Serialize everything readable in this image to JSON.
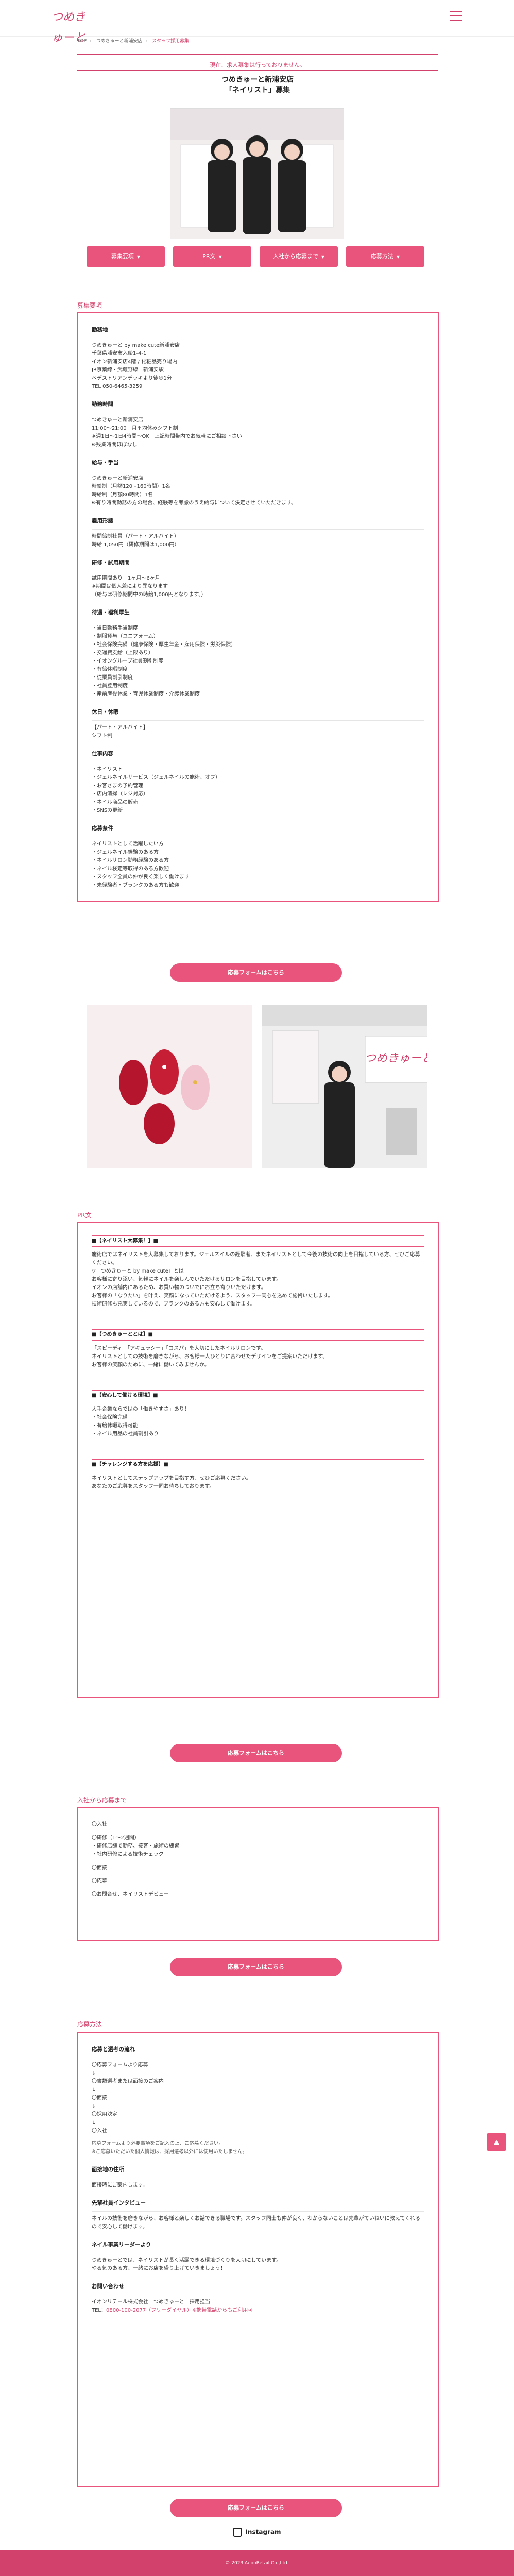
{
  "header": {
    "logo_text": "つめきゅーと"
  },
  "breadcrumb": {
    "home": "TOP",
    "area": "つめきゅーと新浦安店",
    "current": "スタッフ採用募集"
  },
  "notice": "現在、求人募集は行っておりません。",
  "shop": {
    "line1": "つめきゅーと新浦安店",
    "line2": "「ネイリスト」募集"
  },
  "nav": {
    "b1": "募集要項",
    "b2": "PR文",
    "b3": "入社から応募まで",
    "b4": "応募方法"
  },
  "recruit": {
    "label": "募集要項",
    "company_h": "勤務地",
    "company": "つめきゅーと by make cute新浦安店\n千葉県浦安市入船1-4-1\nイオン新浦安店4階 / 化粧品売り場内\n JR京葉線・武蔵野線　新浦安駅\n ペデストリアンデッキより徒歩1分\nTEL 050-6465-3259",
    "hours_h": "勤務時間",
    "hours": "つめきゅーと新浦安店\n11:00～21:00　月平均休みシフト制\n※週1日～1日4時間～OK　上記時間帯内でお気軽にご相談下さい\n※残業時間ほぼなし",
    "salary_h": "給与・手当",
    "salary": "つめきゅーと新浦安店\n時給制（月額120~160時間）1名\n時給制（月額80時間）1名\n※有り時間勤務の方の場合、経験等を考慮のうえ給与について決定させていただきます。",
    "type_h": "雇用形態",
    "type": "時間給制社員（パート・アルバイト）\n時給 1,050円（研修期間は1,000円）",
    "trial_h": "研修・試用期間",
    "trial": "試用期間あり　1ヶ月～6ヶ月\n※期間は個人差により異なります\n（給与は研修期間中の時給1,000円となります。）",
    "welfare_h": "待遇・福利厚生",
    "welfare": "・当日勤務手当制度\n・制服貸与（ユニフォーム）\n・社会保険完備（健康保険・厚生年金・雇用保険・労災保険）\n・交通費支給（上限あり）\n・イオングループ社員割引制度\n・有給休暇制度\n・従業員割引制度\n・社員登用制度\n・産前産後休業・育児休業制度・介護休業制度",
    "holiday_h": "休日・休暇",
    "holiday": "【パート・アルバイト】\nシフト制",
    "qual_h": "仕事内容",
    "qual": "・ネイリスト\n・ジェルネイルサービス（ジェルネイルの施術、オフ）\n・お客さまの予約管理\n・店内清掃（レジ対応）\n・ネイル商品の販売\n・SNSの更新",
    "apply_h": "応募条件",
    "apply": "ネイリストとして活躍したい方\n・ジェルネイル経験のある方\n・ネイルサロン勤務経験のある方\n・ネイル検定等取得のある方歓迎\n・スタッフ全員の仲が良く楽しく働けます\n・未経験者・ブランクのある方も歓迎"
  },
  "apply_button": "応募フォームはこちら",
  "pr": {
    "label": "PR文",
    "s1_title": "■【ネイリスト大募集！】■",
    "s1_body": "施術店ではネイリストを大募集しております。ジェルネイルの経験者、またネイリストとして今後の技術の向上を目指している方、ぜひご応募ください。\n▽「つめきゅーと by make cute」とは\nお客様に寄り添い、気軽にネイルを楽しんでいただけるサロンを目指しています。\nイオンの店舗内にあるため、お買い物のついでにお立ち寄りいただけます。\nお客様の「なりたい」を叶え、笑顔になっていただけるよう、スタッフ一同心を込めて施術いたします。\n技術研修も充実しているので、ブランクのある方も安心して働けます。",
    "s2_title": "■【つめきゅーととは】■",
    "s2_body": "「スピーディ」「アキュラシー」「コスパ」を大切にしたネイルサロンです。\nネイリストとしての技術を磨きながら、お客様一人ひとりに合わせたデザインをご提案いただけます。\nお客様の笑顔のために、一緒に働いてみませんか。",
    "s3_title": "■【安心して働ける環境】■",
    "s3_body": "大手企業ならではの「働きやすさ」あり！\n・社会保険完備\n・有給休暇取得可能\n・ネイル用品の社員割引あり",
    "s4_title": "■【チャレンジする方を応援】■",
    "s4_body": "ネイリストとしてステップアップを目指す方、ぜひご応募ください。\nあなたのご応募をスタッフ一同お待ちしております。"
  },
  "flow": {
    "label": "入社から応募まで",
    "steps": [
      "〇入社",
      "〇研修（1～2週間）\n・研修店舗で勤務、接客・施術の練習\n・社内研修による技術チェック",
      "〇面接",
      "〇応募",
      "〇お問合せ、ネイリストデビュー"
    ]
  },
  "howto": {
    "label": "応募方法",
    "h1": "応募と選考の流れ",
    "steps": "〇応募フォームより応募\n↓\n〇書類選考または面接のご案内\n↓\n〇面接\n↓\n〇採用決定\n↓\n〇入社",
    "note": "応募フォームより必要事項をご記入の上、ご応募ください。\n※ご応募いただいた個人情報は、採用選考以外には使用いたしません。",
    "h2": "面接地の住所",
    "h2_body": "面接時にご案内します。",
    "h3": "先輩社員インタビュー",
    "h3_body": "ネイルの技術を磨きながら、お客様と楽しくお話できる職場です。スタッフ同士も仲が良く、わからないことは先輩がていねいに教えてくれるので安心して働けます。",
    "h4": "ネイル事業リーダーより",
    "h4_body": "つめきゅーとでは、ネイリストが長く活躍できる環境づくりを大切にしています。\nやる気のある方、一緒にお店を盛り上げていきましょう！",
    "h5": "お問い合わせ",
    "h5_body": "イオンリテール株式会社　つめきゅーと　採用担当",
    "tel_label": "TEL：",
    "tel": "0800-100-2077（フリーダイヤル）※携帯電話からもご利用可"
  },
  "instagram": "Instagram",
  "copyright": "© 2023 AeonRetail Co.,Ltd.",
  "colors": {
    "accent": "#e8547b",
    "brand": "#d2416b"
  },
  "icons": {
    "scroll_top": "arrow-up-icon",
    "instagram": "instagram-icon"
  }
}
